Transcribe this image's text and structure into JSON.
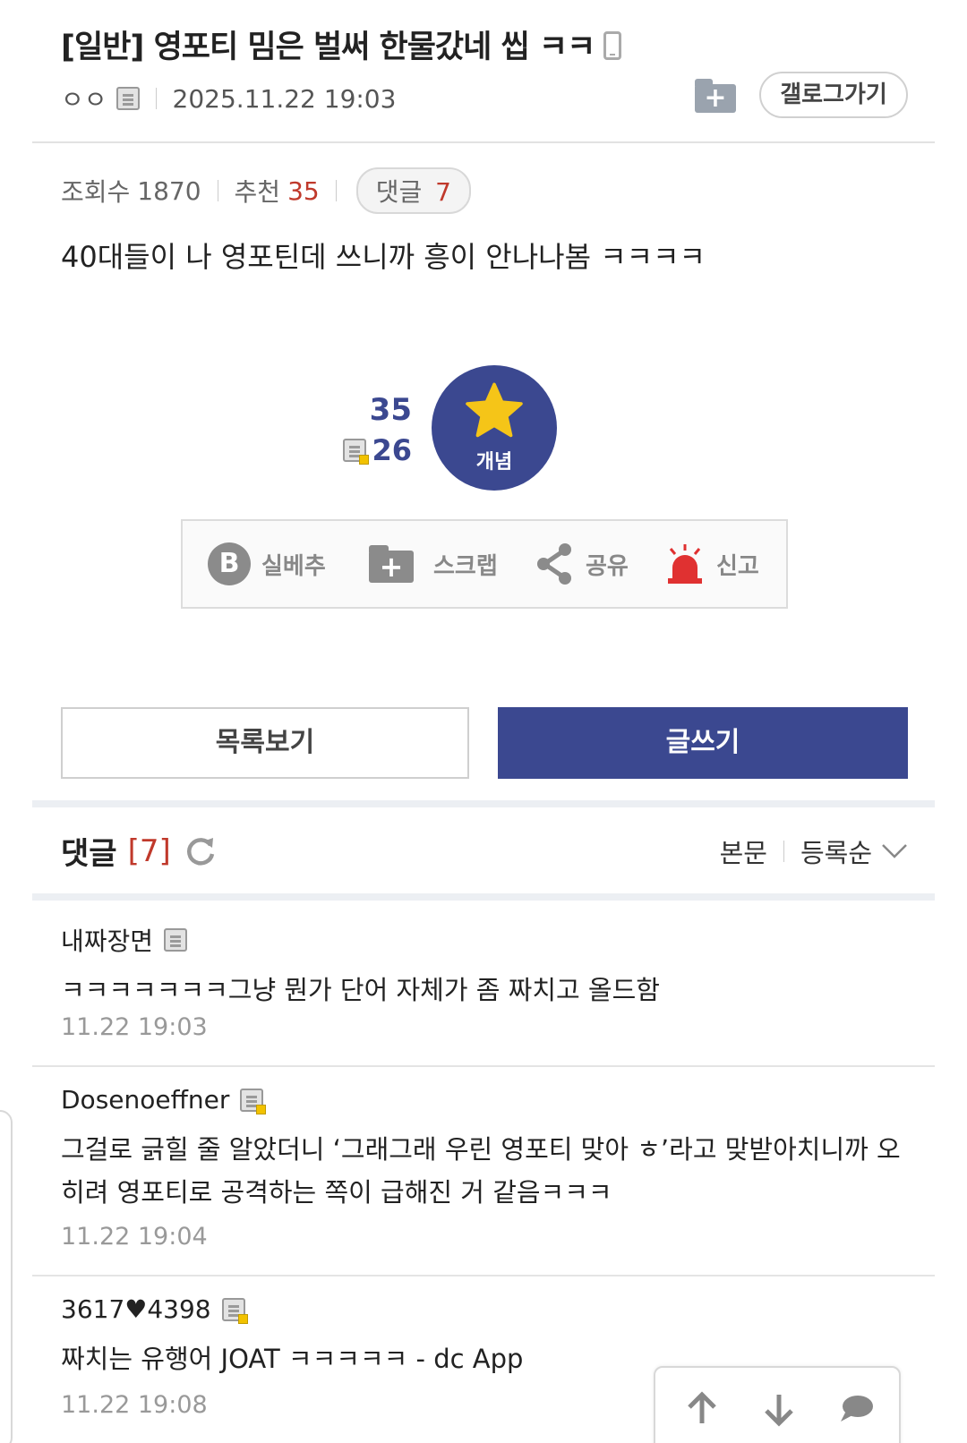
{
  "post": {
    "title": "[일반] 영포티 밈은 벌써 한물갔네 씹 ㅋㅋ",
    "author": "ㅇㅇ",
    "datetime": "2025.11.22 19:03",
    "gallery_button": "갤로그가기",
    "body": "40대들이 나 영포틴데 쓰니까 흥이 안나나봄 ㅋㅋㅋㅋ"
  },
  "stats": {
    "views_label": "조회수",
    "views": "1870",
    "rec_label": "추천",
    "rec": "35",
    "comments_label": "댓글",
    "comments": "7"
  },
  "recommend": {
    "count": "35",
    "fixed_count": "26",
    "button_label": "개념"
  },
  "actions": {
    "silbe": "실베추",
    "scrap": "스크랩",
    "share": "공유",
    "report": "신고"
  },
  "buttons": {
    "list": "목록보기",
    "write": "글쓰기"
  },
  "comments_section": {
    "title": "댓글",
    "count": "[7]",
    "sort_body": "본문",
    "sort_order": "등록순",
    "items": [
      {
        "author": "내짜장면",
        "text": "ㅋㅋㅋㅋㅋㅋㅋ그냥 뭔가 단어 자체가 좀 짜치고 올드함",
        "date": "11.22 19:03"
      },
      {
        "author": "Dosenoeffner",
        "text": "그걸로 긁힐 줄 알았더니 ‘그래그래 우린 영포티 맞아 ㅎ’라고 맞받아치니까 오히려 영포티로 공격하는 쪽이 급해진 거 같음ㅋㅋㅋ",
        "date": "11.22 19:04"
      },
      {
        "author": "3617♥4398",
        "text": "짜치는 유행어 JOAT ㅋㅋㅋㅋㅋ - dc App",
        "date": "11.22 19:08"
      }
    ]
  },
  "colors": {
    "brand": "#3b4890",
    "accent_red": "#c0392b",
    "star": "#f5c518",
    "report_red": "#e03131"
  }
}
